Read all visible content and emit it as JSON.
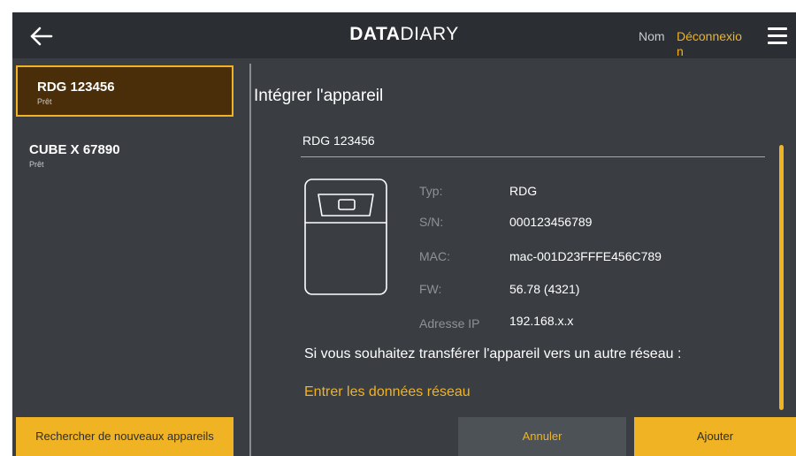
{
  "header": {
    "brand_bold": "DATA",
    "brand_light": "DIARY",
    "user_label": "Nom",
    "logout_label": "Déconnexion"
  },
  "sidebar": {
    "devices": [
      {
        "name": "RDG 123456",
        "status": "Prêt",
        "selected": true
      },
      {
        "name": "CUBE X 67890",
        "status": "Prêt",
        "selected": false
      }
    ],
    "search_button": "Rechercher de nouveaux appareils"
  },
  "main": {
    "title": "Intégrer l'appareil",
    "device_name_value": "RDG 123456",
    "info": [
      {
        "label": "Typ:",
        "value": "RDG"
      },
      {
        "label": "S/N:",
        "value": "000123456789"
      },
      {
        "label": "MAC:",
        "value": "mac-001D23FFFE456C789"
      },
      {
        "label": "FW:",
        "value": "56.78 (4321)"
      },
      {
        "label": "Adresse IP",
        "value": "192.168.x.x"
      }
    ],
    "transfer_text": "Si vous souhaitez transférer l'appareil vers un autre réseau :",
    "transfer_link": "Entrer les données réseau",
    "cancel_button": "Annuler",
    "add_button": "Ajouter"
  },
  "icons": {
    "back": "arrow-left-icon",
    "menu": "hamburger-menu-icon",
    "device": "device-outline-icon"
  },
  "colors": {
    "accent": "#f0b323",
    "background": "#3a3e42",
    "topbar": "#2b2f33",
    "selected_item": "#4a2e0a"
  }
}
